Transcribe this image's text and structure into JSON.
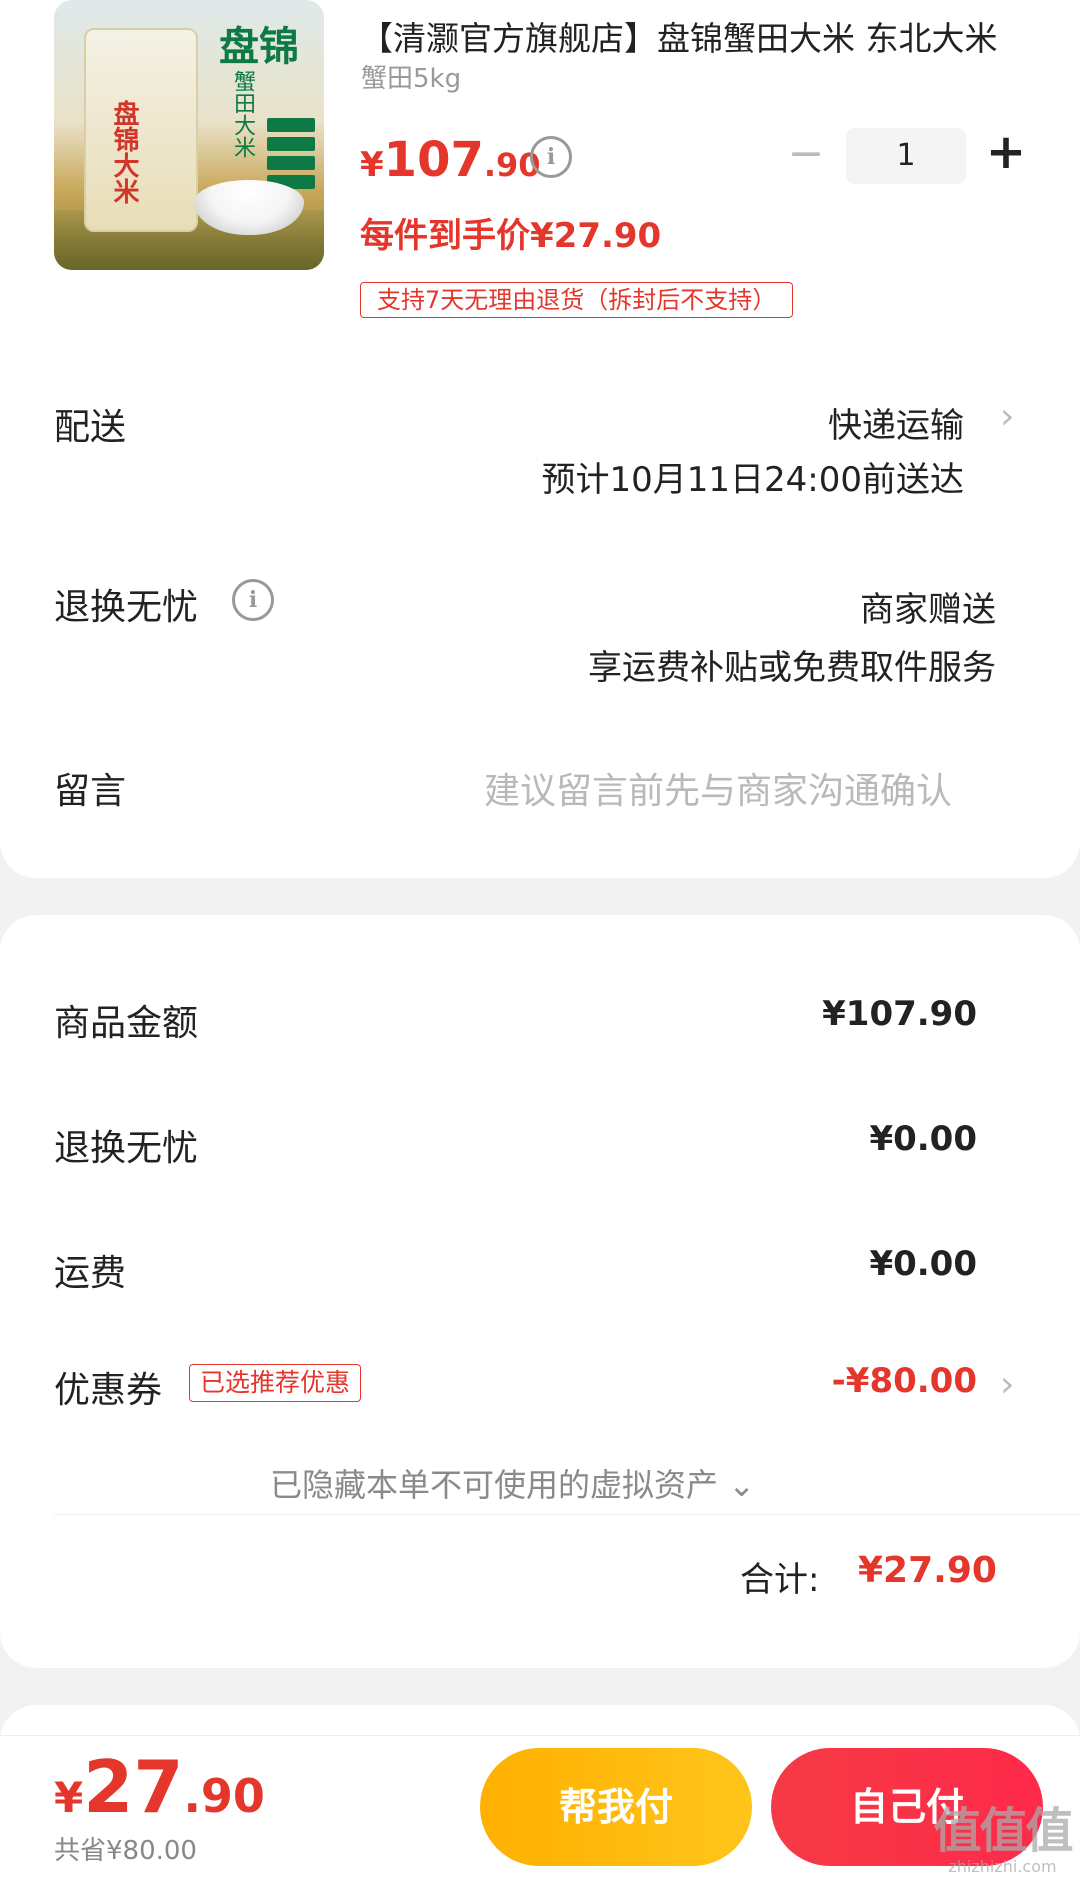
{
  "product": {
    "title": "【清灏官方旗舰店】盘锦蟹田大米 东北大米",
    "spec": "蟹田5kg",
    "price": {
      "symbol": "¥",
      "integer": "107",
      "decimal": ".90"
    },
    "unit_price": "每件到手价¥27.90",
    "quantity": "1",
    "minus": "−",
    "plus": "+",
    "return_tag": "支持7天无理由退货（拆封后不支持）",
    "image": {
      "brand_logo": "盘锦",
      "brand_sub": "蟹田大米",
      "bag_title": "盘锦大米"
    }
  },
  "delivery": {
    "label": "配送",
    "method": "快递运输",
    "eta": "预计10月11日24:00前送达"
  },
  "worry_free": {
    "label": "退换无忧",
    "value": "商家赠送",
    "desc": "享运费补贴或免费取件服务"
  },
  "message": {
    "label": "留言",
    "placeholder": "建议留言前先与商家沟通确认"
  },
  "summary": {
    "goods_amount": {
      "label": "商品金额",
      "value": "¥107.90"
    },
    "worry_free_fee": {
      "label": "退换无忧",
      "value": "¥0.00"
    },
    "shipping": {
      "label": "运费",
      "value": "¥0.00"
    },
    "coupon": {
      "label": "优惠券",
      "badge": "已选推荐优惠",
      "value": "-¥80.00"
    },
    "hidden_note": "已隐藏本单不可使用的虚拟资产",
    "total_label": "合计:",
    "total_value": "¥27.90"
  },
  "bottom_bar": {
    "price": {
      "symbol": "¥",
      "integer": "27",
      "decimal": ".90"
    },
    "saved": "共省¥80.00",
    "help_pay": "帮我付",
    "self_pay": "自己付"
  },
  "info_glyph": "i",
  "chevron_glyph": "›",
  "chevron_down_glyph": "⌄",
  "watermark": {
    "big": "值值值",
    "small": "zhizhizhi.com"
  },
  "colors": {
    "accent_red": "#e4362b",
    "help_button": "#ffb000",
    "self_button": "#f53a45"
  }
}
